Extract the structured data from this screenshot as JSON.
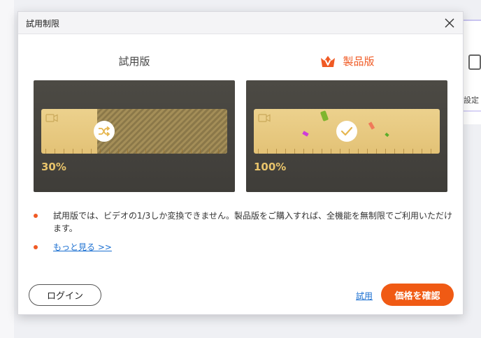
{
  "background": {
    "right_panel_text": "設定"
  },
  "dialog": {
    "title": "試用制限",
    "plans": {
      "trial_label": "試用版",
      "pro_label": "製品版",
      "trial_percent": "30%",
      "pro_percent": "100%",
      "trial_fraction": 0.3,
      "pro_fraction": 1.0
    },
    "notes": [
      "試用版では、ビデオの1/3しか変換できません。製品版をご購入すれば、全機能を無制限でご利用いただけます。",
      "もっと見る >>"
    ],
    "buttons": {
      "login": "ログイン",
      "trial": "試用",
      "buy": "価格を確認"
    },
    "colors": {
      "accent": "#f05a14",
      "link": "#1a6fd1",
      "gold": "#e9c46b"
    },
    "icons": {
      "close": "close-icon",
      "crown": "crown-icon",
      "shuffle": "shuffle-icon",
      "check": "check-icon",
      "camera": "video-camera-icon"
    }
  }
}
